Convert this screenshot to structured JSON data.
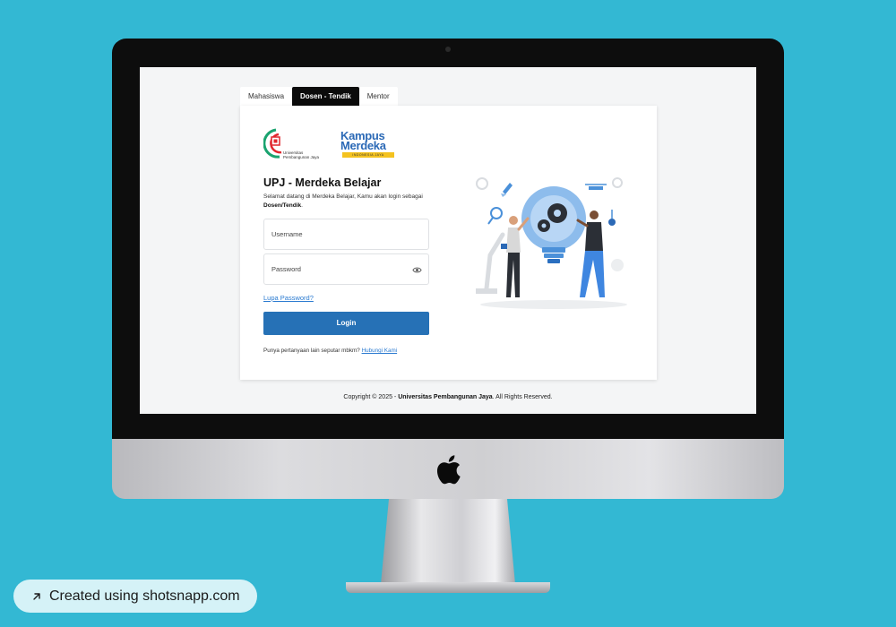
{
  "tabs": [
    {
      "label": "Mahasiswa",
      "active": false
    },
    {
      "label": "Dosen - Tendik",
      "active": true
    },
    {
      "label": "Mentor",
      "active": false
    }
  ],
  "logos": {
    "upj_text_line1": "Universitas",
    "upj_text_line2": "Pembangunan Jaya",
    "km_line1": "Kampus",
    "km_line2": "Merdeka",
    "km_strip": "INDONESIA JAYA"
  },
  "login": {
    "title": "UPJ - Merdeka Belajar",
    "subtitle_part1": "Selamat datang di Merdeka Belajar, Kamu akan login sebagai ",
    "subtitle_role": "Dosen/Tendik",
    "subtitle_end": ".",
    "username_placeholder": "Username",
    "password_placeholder": "Password",
    "forgot_label": "Lupa Password?",
    "button_label": "Login",
    "help_text": "Punya pertanyaan lain seputar mbkm? ",
    "help_link": "Hubungi Kami"
  },
  "footer": {
    "prefix": "Copyright © 2025 - ",
    "org": "Universitas Pembangunan Jaya",
    "suffix": ". All Rights Reserved."
  },
  "badge": {
    "label": "Created using shotsnapp.com"
  },
  "colors": {
    "background": "#33b8d3",
    "primary": "#2671b6",
    "link": "#2a7ad0",
    "active_tab": "#0b0b0b"
  }
}
